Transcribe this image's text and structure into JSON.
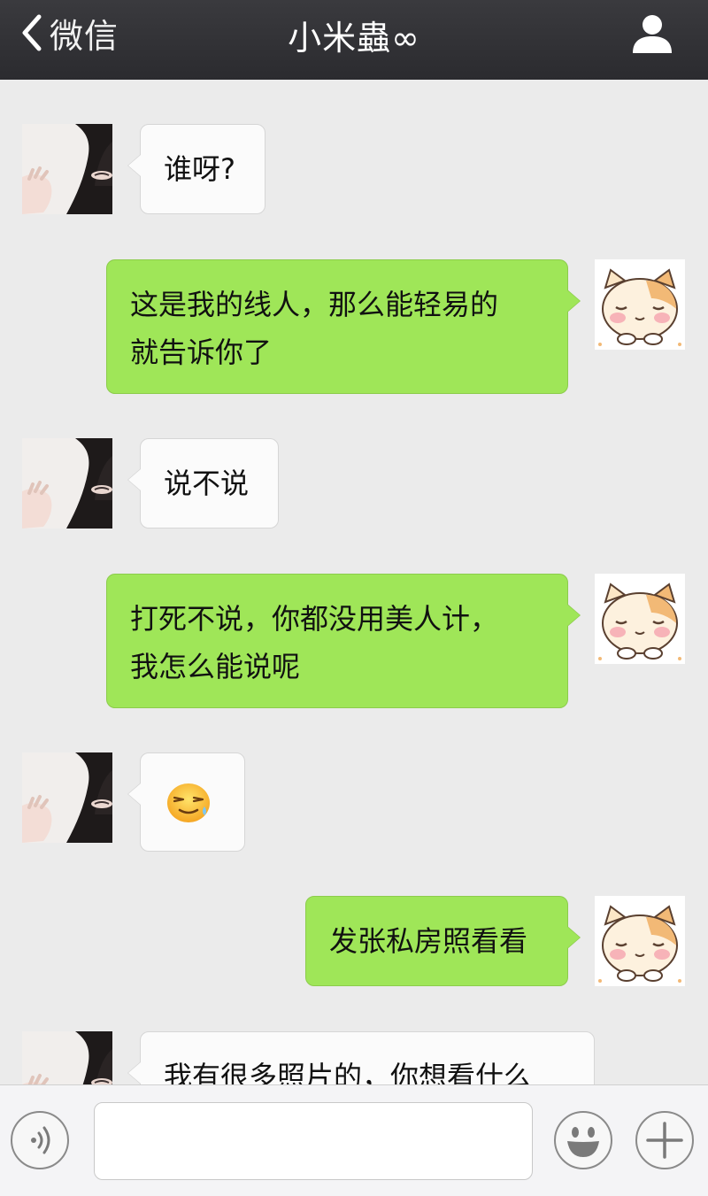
{
  "header": {
    "back_label": "微信",
    "title": "小米蟲∞",
    "back_icon": "chevron-left-icon",
    "profile_icon": "person-icon"
  },
  "messages": [
    {
      "side": "in",
      "text": "谁呀?"
    },
    {
      "side": "out",
      "lines": [
        "这是我的线人，那么能轻易的",
        "就告诉你了"
      ]
    },
    {
      "side": "in",
      "text": "说不说"
    },
    {
      "side": "out",
      "lines": [
        "打死不说，你都没用美人计，",
        "我怎么能说呢"
      ]
    },
    {
      "side": "in",
      "emoji": "sweat-smile-emoji"
    },
    {
      "side": "out",
      "text": "发张私房照看看"
    },
    {
      "side": "in",
      "text": "我有很多照片的，你想看什么"
    }
  ],
  "input_bar": {
    "voice_icon": "voice-icon",
    "message_value": "",
    "emoji_icon": "smiley-icon",
    "more_icon": "plus-icon"
  },
  "colors": {
    "header_bg": "#2f2f33",
    "chat_bg": "#ebebeb",
    "outgoing_bubble": "#9fe658",
    "incoming_bubble": "#fbfbfb"
  }
}
